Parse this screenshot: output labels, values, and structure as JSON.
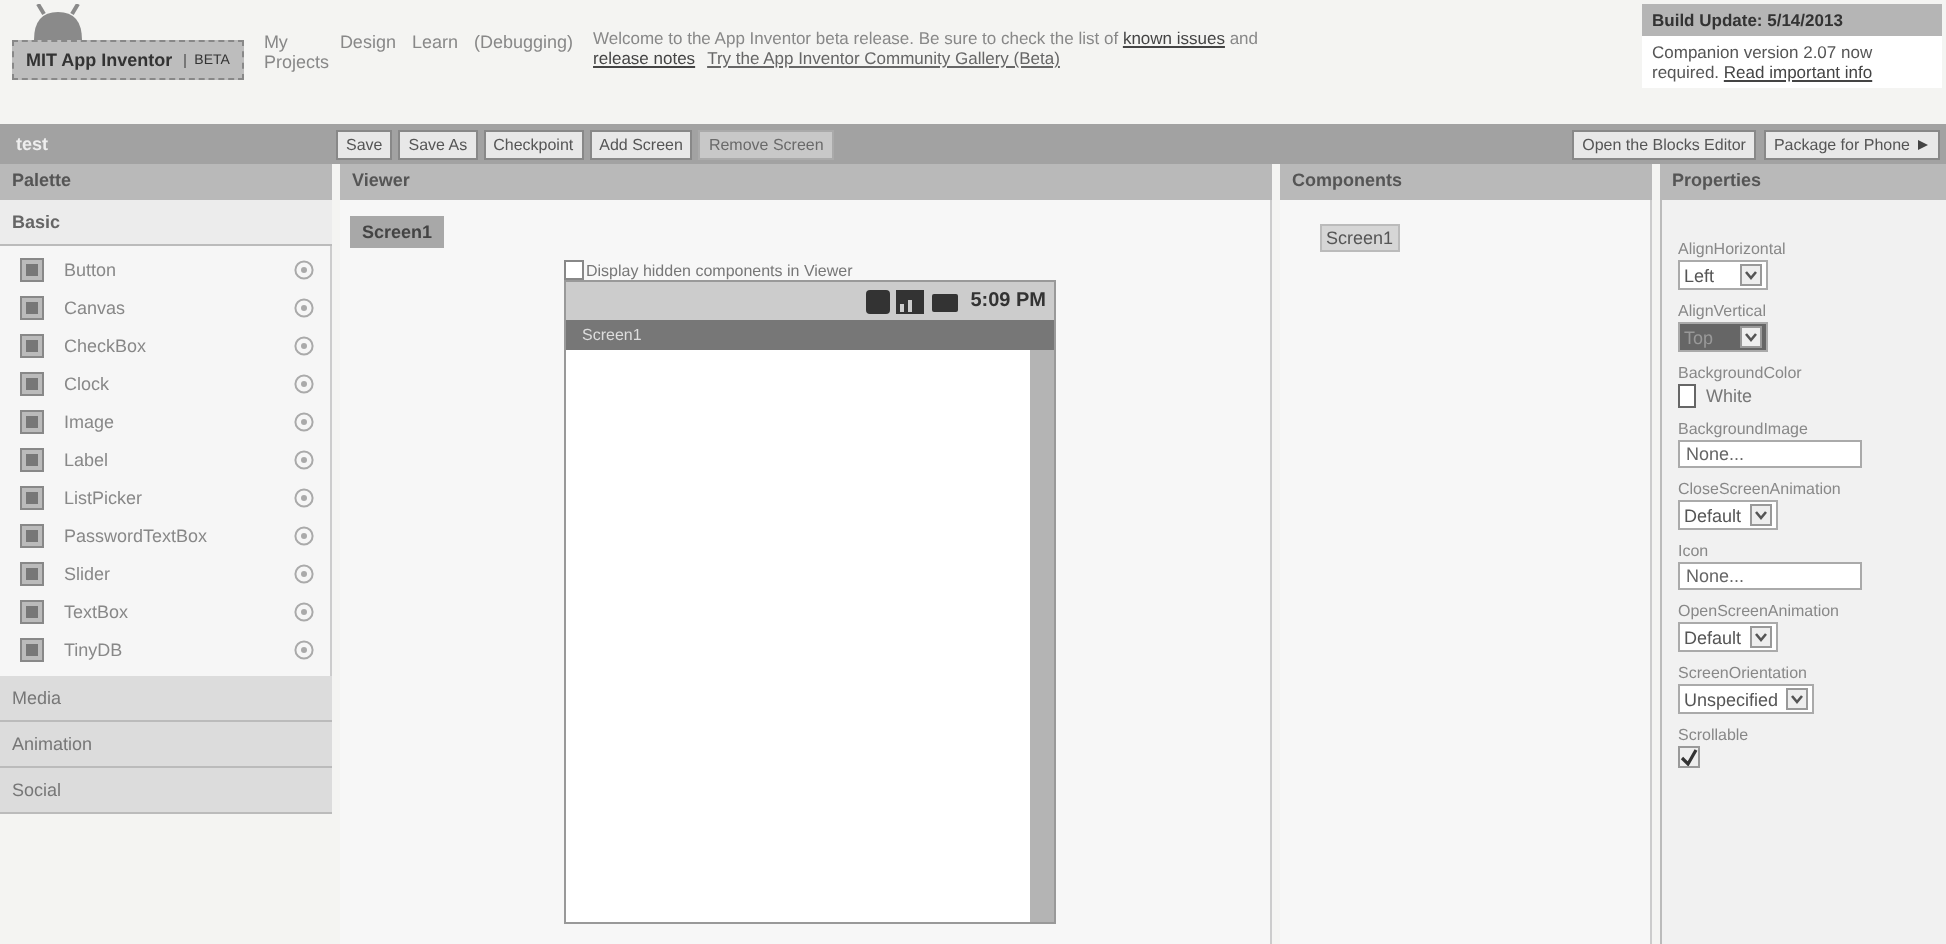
{
  "header": {
    "logo": "MIT App Inventor",
    "badge": "BETA",
    "nav": [
      {
        "label": "My Projects"
      },
      {
        "label": "Design"
      },
      {
        "label": "Learn"
      },
      {
        "label": "(Debugging)"
      }
    ],
    "welcome": "Welcome to the App Inventor beta release. Be sure to check the list of ",
    "welcome_link": "known issues",
    "welcome_mid": " and ",
    "notes_link": "release notes",
    "gallery_link": "Try the App Inventor Community Gallery (Beta)",
    "update_title": "Build Update: 5/14/2013",
    "update_text": "Companion version 2.07 now required. ",
    "update_link": "Read important info"
  },
  "toolbar": {
    "project": "test",
    "buttons": [
      {
        "label": "Save",
        "disabled": false
      },
      {
        "label": "Save As",
        "disabled": false
      },
      {
        "label": "Checkpoint",
        "disabled": false
      },
      {
        "label": "Add Screen",
        "disabled": false
      },
      {
        "label": "Remove Screen",
        "disabled": true
      }
    ],
    "right_buttons": [
      {
        "label": "Open the Blocks Editor",
        "menu": false
      },
      {
        "label": "Package for Phone",
        "menu": true
      }
    ]
  },
  "palette": {
    "title": "Palette",
    "sections": [
      {
        "label": "Basic",
        "expanded": true,
        "items": [
          {
            "label": "Button"
          },
          {
            "label": "Canvas"
          },
          {
            "label": "CheckBox"
          },
          {
            "label": "Clock"
          },
          {
            "label": "Image"
          },
          {
            "label": "Label"
          },
          {
            "label": "ListPicker"
          },
          {
            "label": "PasswordTextBox"
          },
          {
            "label": "Slider"
          },
          {
            "label": "TextBox"
          },
          {
            "label": "TinyDB"
          }
        ]
      },
      {
        "label": "Media",
        "expanded": false
      },
      {
        "label": "Animation",
        "expanded": false
      },
      {
        "label": "Social",
        "expanded": false
      }
    ]
  },
  "viewer": {
    "title": "Viewer",
    "screen_tab": "Screen1",
    "hidden_checkbox": {
      "label": "Display hidden components in Viewer",
      "checked": false
    },
    "phone": {
      "time": "5:09 PM",
      "title": "Screen1"
    }
  },
  "components": {
    "title": "Components",
    "tree": [
      {
        "label": "Screen1",
        "selected": true
      }
    ]
  },
  "properties": {
    "title": "Properties",
    "items": [
      {
        "kind": "select",
        "label": "AlignHorizontal",
        "value": "Left",
        "highlighted": false
      },
      {
        "kind": "select",
        "label": "AlignVertical",
        "value": "Top",
        "highlighted": true
      },
      {
        "kind": "color",
        "label": "BackgroundColor",
        "value": "White"
      },
      {
        "kind": "text",
        "label": "BackgroundImage",
        "value": "None..."
      },
      {
        "kind": "select",
        "label": "CloseScreenAnimation",
        "value": "Default",
        "highlighted": false
      },
      {
        "kind": "text",
        "label": "Icon",
        "value": "None..."
      },
      {
        "kind": "select",
        "label": "OpenScreenAnimation",
        "value": "Default",
        "highlighted": false
      },
      {
        "kind": "select",
        "label": "ScreenOrientation",
        "value": "Unspecified",
        "highlighted": false
      },
      {
        "kind": "check",
        "label": "Scrollable",
        "checked": true
      }
    ]
  }
}
